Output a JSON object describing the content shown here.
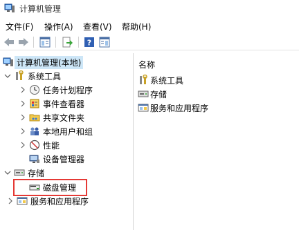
{
  "window": {
    "title": "计算机管理"
  },
  "menu": [
    "文件(F)",
    "操作(A)",
    "查看(V)",
    "帮助(H)"
  ],
  "tree": {
    "root": "计算机管理(本地)",
    "system_tools": "系统工具",
    "task_scheduler": "任务计划程序",
    "event_viewer": "事件查看器",
    "shared_folders": "共享文件夹",
    "local_users": "本地用户和组",
    "performance": "性能",
    "device_manager": "设备管理器",
    "storage": "存储",
    "disk_management": "磁盘管理",
    "services_apps": "服务和应用程序"
  },
  "right_panel": {
    "column_header": "名称",
    "items": [
      "系统工具",
      "存储",
      "服务和应用程序"
    ]
  },
  "colors": {
    "highlight_border": "#e53935",
    "selection": "#cde6f7"
  }
}
